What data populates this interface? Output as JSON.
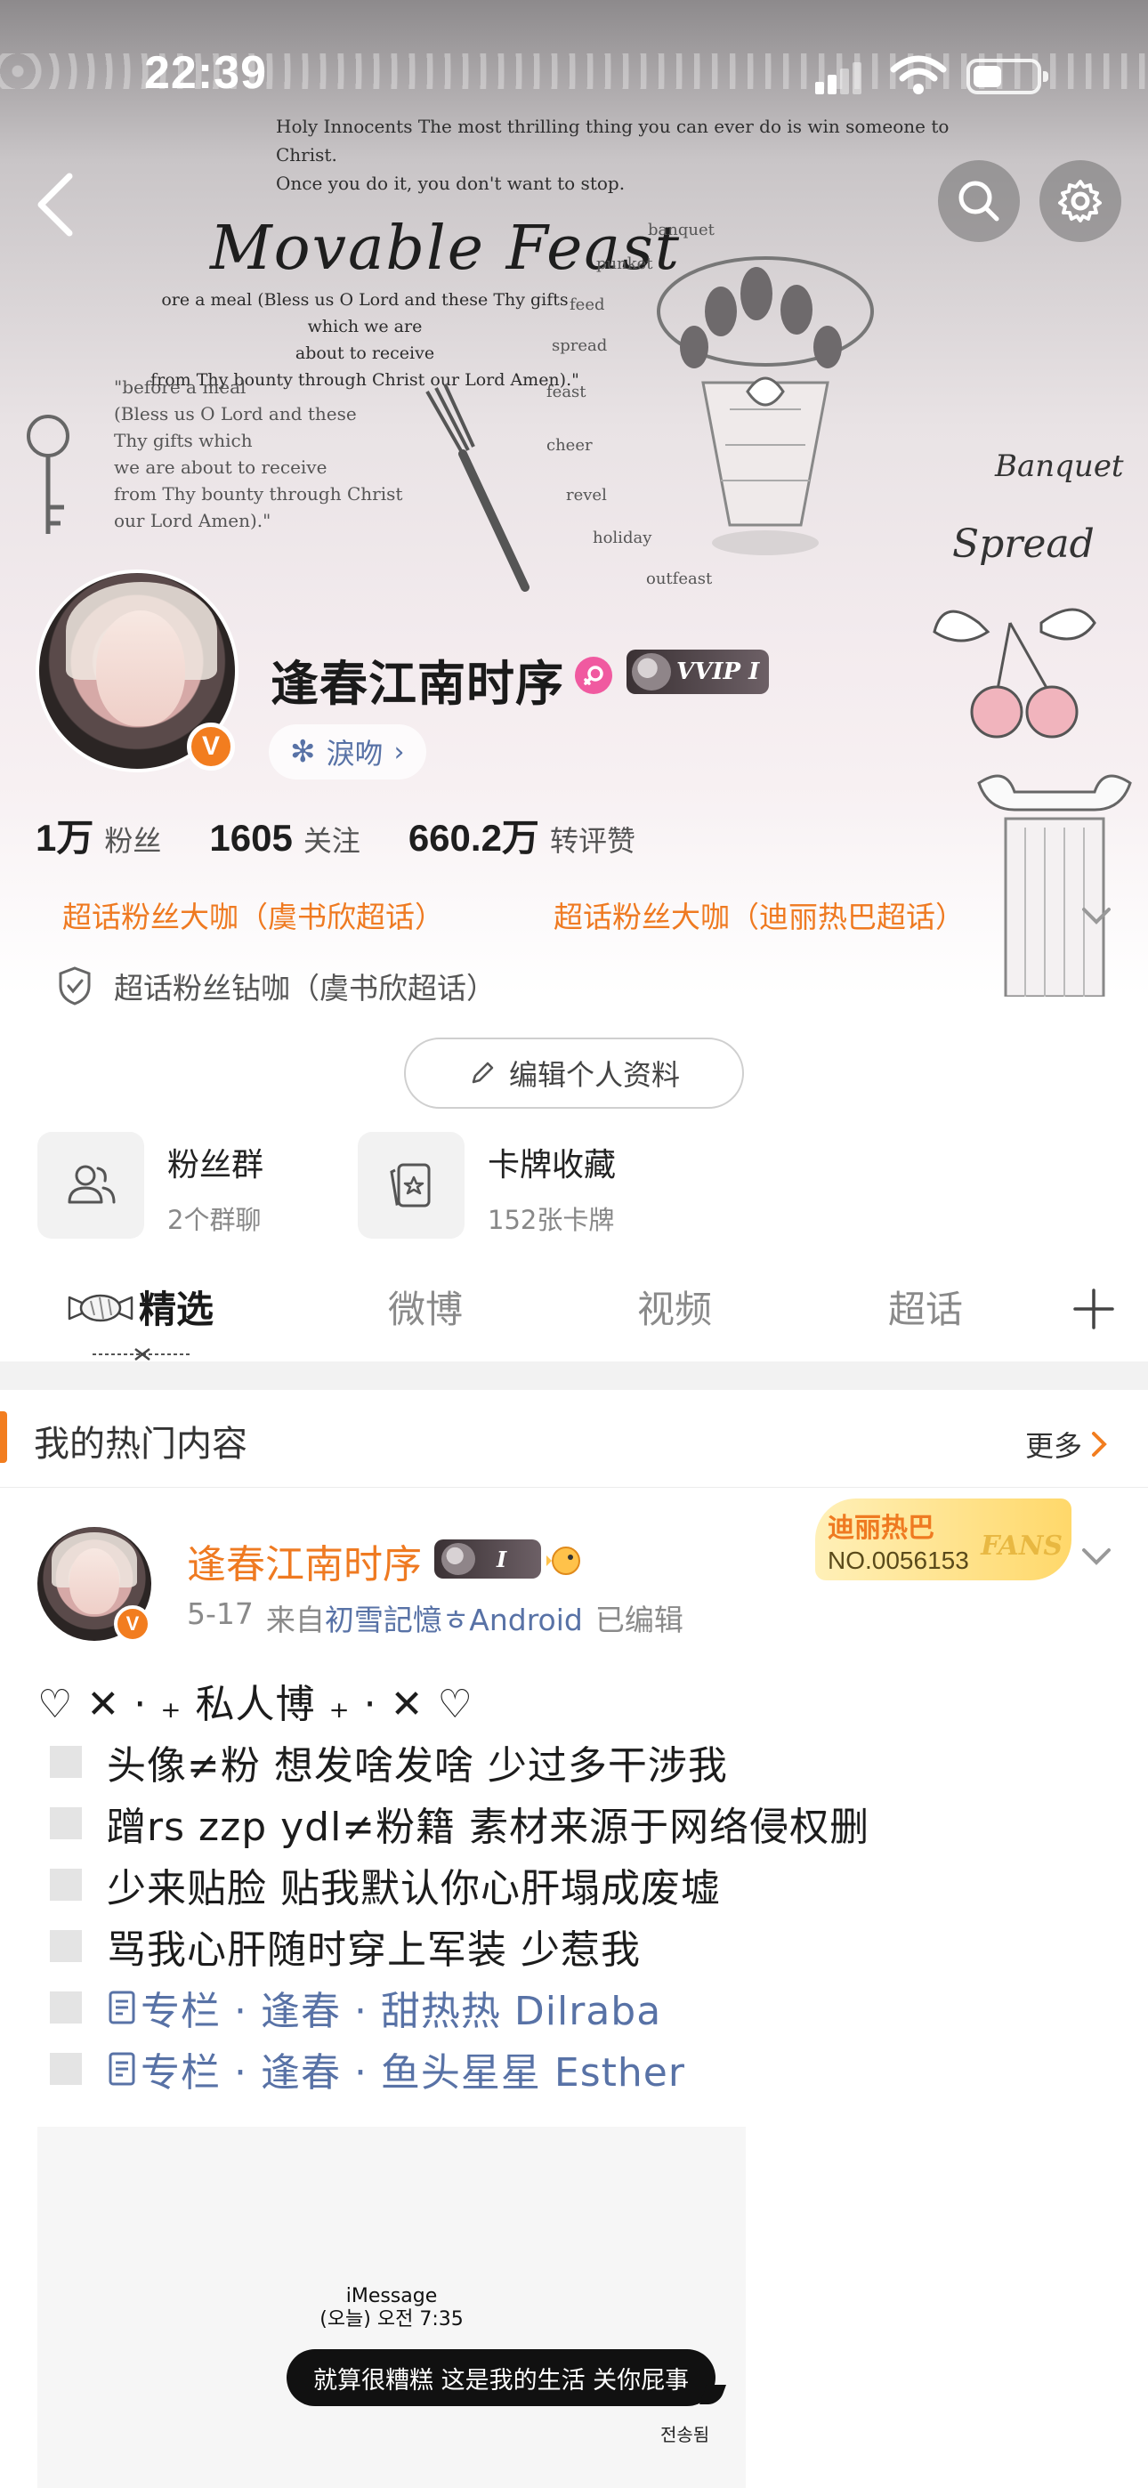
{
  "status_bar": {
    "time": "22:39",
    "battery_level": 0.45
  },
  "banner": {
    "quote_line1": "Holy Innocents The most thrilling thing you can ever do is win someone to Christ.",
    "quote_line2": "Once you do it, you don't want to stop.",
    "title": "Movable Feast",
    "sub_line1": "ore a meal (Bless us O Lord and these Thy gifts which we are",
    "sub_line2": "about to receive",
    "sub_line3": "from Thy bounty through Christ our Lord Amen).\"",
    "left_line1": "\"before a meal",
    "left_line2": "(Bless us O Lord and these",
    "left_line3": "Thy gifts which",
    "left_line4": "we are about to receive",
    "left_line5": "from Thy bounty through Christ",
    "left_line6": "our Lord Amen).\"",
    "words": [
      "banquet",
      "punket",
      "feed",
      "spread",
      "feast",
      "cheer",
      "revel",
      "holiday",
      "outfeast"
    ],
    "script1": "Banquet",
    "script2": "Spread"
  },
  "nav": {
    "back_icon": "chevron-left-icon",
    "search_icon": "search-icon",
    "settings_icon": "gear-icon"
  },
  "profile": {
    "username": "逢春江南时序",
    "verified_badge": "V",
    "vvip_label": "VVIP I",
    "tag_label": "淚吻",
    "accent_color": "#f27d1f",
    "link_color": "#5872a6",
    "stats": [
      {
        "value": "1万",
        "label": "粉丝"
      },
      {
        "value": "1605",
        "label": "关注"
      },
      {
        "value": "660.2万",
        "label": "转评赞"
      }
    ],
    "badges": [
      "超话粉丝大咖（虞书欣超话）",
      "超话粉丝大咖（迪丽热巴超话）"
    ],
    "badge_secondary": "超话粉丝钻咖（虞书欣超话）",
    "edit_button": "编辑个人资料",
    "tiles": [
      {
        "title": "粉丝群",
        "sub": "2个群聊",
        "icon": "group-icon"
      },
      {
        "title": "卡牌收藏",
        "sub": "152张卡牌",
        "icon": "card-icon"
      }
    ]
  },
  "tabs": [
    {
      "label": "精选",
      "active": true
    },
    {
      "label": "微博",
      "active": false
    },
    {
      "label": "视频",
      "active": false
    },
    {
      "label": "超话",
      "active": false
    }
  ],
  "hot": {
    "title": "我的热门内容",
    "more": "更多"
  },
  "post": {
    "author": "逢春江南时序",
    "vvip_label": "I",
    "date": "5-17",
    "from_label": "来自",
    "source": "初雪記憶ㅎAndroid",
    "edited": "已编辑",
    "fans_card": {
      "name": "迪丽热巴",
      "number": "NO.0056153",
      "tag": "FANS"
    },
    "title_line": "♡ ✕ · ₊ 私人博 ₊ · ✕ ♡",
    "lines": [
      "头像≠粉 想发啥发啥 少过多干涉我",
      "蹭rs zzp ydl≠粉籍 素材来源于网络侵权删",
      "少来贴脸 贴我默认你心肝塌成废墟",
      "骂我心肝随时穿上军装 少惹我"
    ],
    "links": [
      "专栏 · 逢春 · 甜热热 Dilraba",
      "专栏 · 逢春 · 鱼头星星 Esther"
    ],
    "image": {
      "header_line1": "iMessage",
      "header_line2": "(오늘) 오전 7:35",
      "bubble": "就算很糟糕 这是我的生活 关你屁事",
      "sender": "전송됨"
    }
  }
}
